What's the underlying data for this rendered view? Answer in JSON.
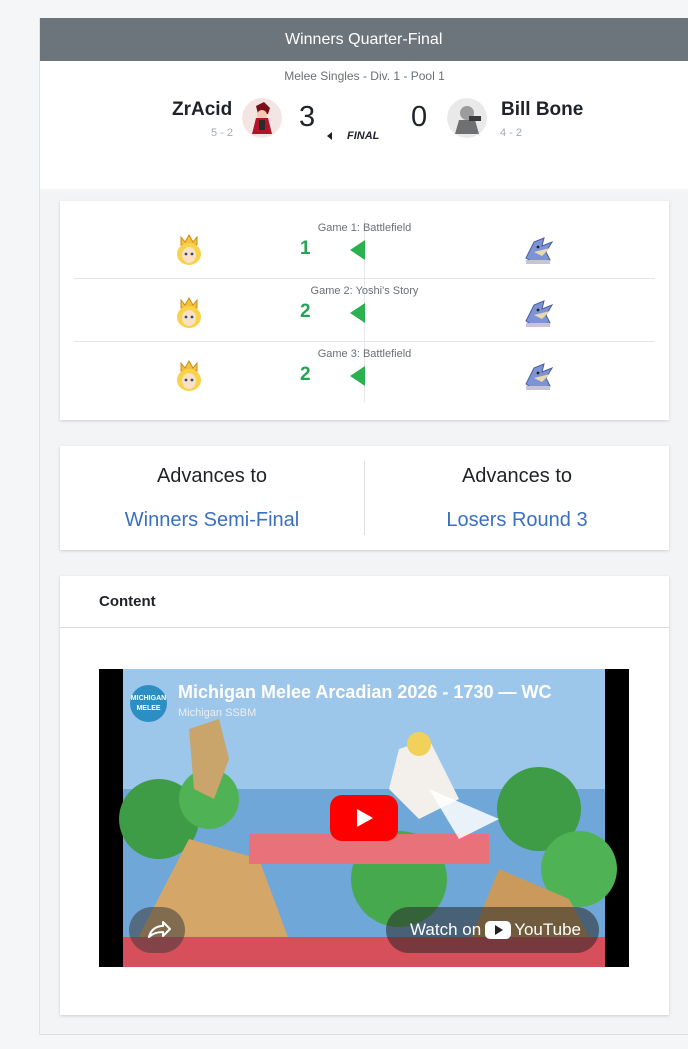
{
  "header": {
    "title": "Winners Quarter-Final"
  },
  "match": {
    "pool": "Melee Singles - Div. 1 - Pool 1",
    "final_label": "FINAL",
    "player1": {
      "name": "ZrAcid",
      "record": "5 - 2",
      "score": "3"
    },
    "player2": {
      "name": "Bill Bone",
      "record": "4 - 2",
      "score": "0"
    }
  },
  "games": [
    {
      "label": "Game 1: Battlefield",
      "winner_score": "1",
      "p1_character_icon": "peach-icon",
      "p2_character_icon": "falco-icon"
    },
    {
      "label": "Game 2: Yoshi's Story",
      "winner_score": "2",
      "p1_character_icon": "peach-icon",
      "p2_character_icon": "falco-icon"
    },
    {
      "label": "Game 3: Battlefield",
      "winner_score": "2",
      "p1_character_icon": "peach-icon",
      "p2_character_icon": "falco-icon"
    }
  ],
  "advances": {
    "left": {
      "heading": "Advances to",
      "link": "Winners Semi-Final"
    },
    "right": {
      "heading": "Advances to",
      "link": "Losers Round 3"
    }
  },
  "content": {
    "heading": "Content",
    "video": {
      "title": "Michigan Melee Arcadian 2026 - 1730 — WC",
      "channel": "Michigan SSBM",
      "channel_logo_text": "MICHIGAN MELEE",
      "watch_label": "Watch on",
      "watch_brand": "YouTube"
    }
  },
  "colors": {
    "title_bar": "#6c747c",
    "winner_green": "#24a455",
    "link_blue": "#3b6fc4",
    "youtube_red": "#ff0000"
  }
}
